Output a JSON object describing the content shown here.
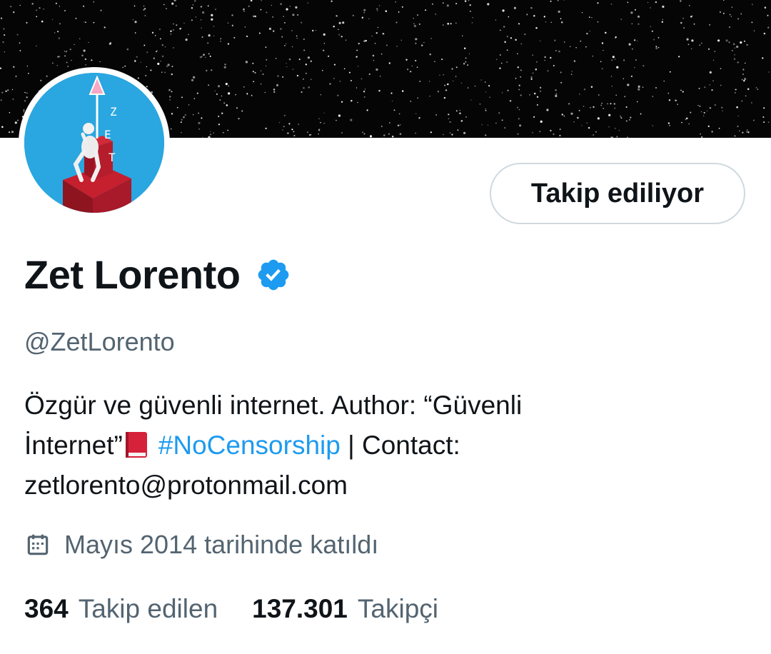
{
  "profile": {
    "name": "Zet Lorento",
    "handle": "@ZetLorento",
    "follow_button_label": "Takip ediliyor",
    "avatar_letters": [
      "Z",
      "E",
      "T"
    ],
    "bio": {
      "line1": "Özgür ve güvenli internet. Author: “Güvenli",
      "line2_start": "İnternet”",
      "hashtag": "#NoCensorship",
      "line2_end": " | Contact:",
      "line3": "zetlorento@protonmail.com"
    },
    "joined": "Mayıs 2014 tarihinde katıldı",
    "stats": {
      "following_count": "364",
      "following_label": "Takip edilen",
      "followers_count": "137.301",
      "followers_label": "Takipçi"
    }
  },
  "icons": {
    "verified": "verified-badge-icon",
    "calendar": "calendar-icon",
    "book": "red-book-emoji"
  },
  "colors": {
    "accent": "#1d9bf0",
    "text": "#0f1419",
    "secondary_text": "#536471",
    "banner": "#050505",
    "avatar_background": "#2aa6e0"
  }
}
